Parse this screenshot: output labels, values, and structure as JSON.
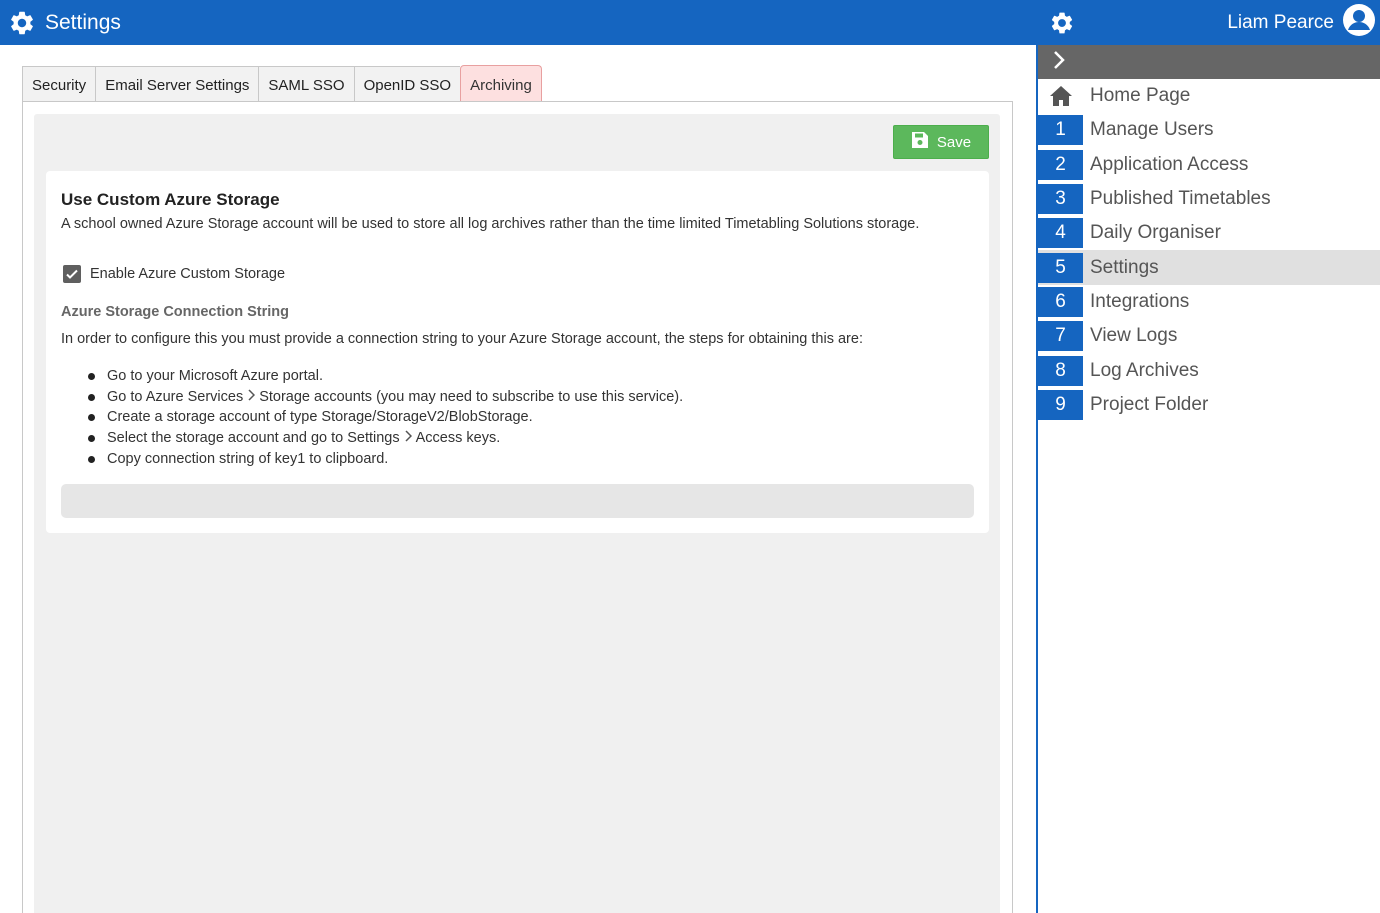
{
  "header": {
    "title": "Settings",
    "icon": "gear-icon"
  },
  "tabs": [
    {
      "label": "Security"
    },
    {
      "label": "Email Server Settings"
    },
    {
      "label": "SAML SSO"
    },
    {
      "label": "OpenID SSO"
    },
    {
      "label": "Archiving",
      "active": true
    }
  ],
  "toolbar": {
    "save_label": "Save"
  },
  "card": {
    "title": "Use Custom Azure Storage",
    "description": "A school owned Azure Storage account will be used to store all log archives rather than the time limited Timetabling Solutions storage.",
    "checkbox_label": "Enable Azure Custom Storage",
    "checkbox_checked": true,
    "section_title": "Azure Storage Connection String",
    "instructions": "In order to configure this you must provide a connection string to your Azure Storage account, the steps for obtaining this are:",
    "steps": {
      "s1": "Go to your Microsoft Azure portal.",
      "s2a": "Go to Azure Services",
      "s2b": "Storage accounts (you may need to subscribe to use this service).",
      "s3": "Create a storage account of type Storage/StorageV2/BlobStorage.",
      "s4a": "Select the storage account and go to Settings",
      "s4b": "Access keys.",
      "s5": "Copy connection string of key1 to clipboard."
    },
    "connection_value": ""
  },
  "sidebar": {
    "user_name": "Liam Pearce",
    "items": [
      {
        "num": "",
        "label": "Home Page",
        "icon": "home-icon"
      },
      {
        "num": "1",
        "label": "Manage Users"
      },
      {
        "num": "2",
        "label": "Application Access"
      },
      {
        "num": "3",
        "label": "Published Timetables"
      },
      {
        "num": "4",
        "label": "Daily Organiser"
      },
      {
        "num": "5",
        "label": "Settings",
        "active": true
      },
      {
        "num": "6",
        "label": "Integrations"
      },
      {
        "num": "7",
        "label": "View Logs"
      },
      {
        "num": "8",
        "label": "Log Archives"
      },
      {
        "num": "9",
        "label": "Project Folder"
      }
    ]
  },
  "colors": {
    "brand": "#1565c0",
    "save": "#5cb85c",
    "active_tab": "#fde0e0"
  }
}
